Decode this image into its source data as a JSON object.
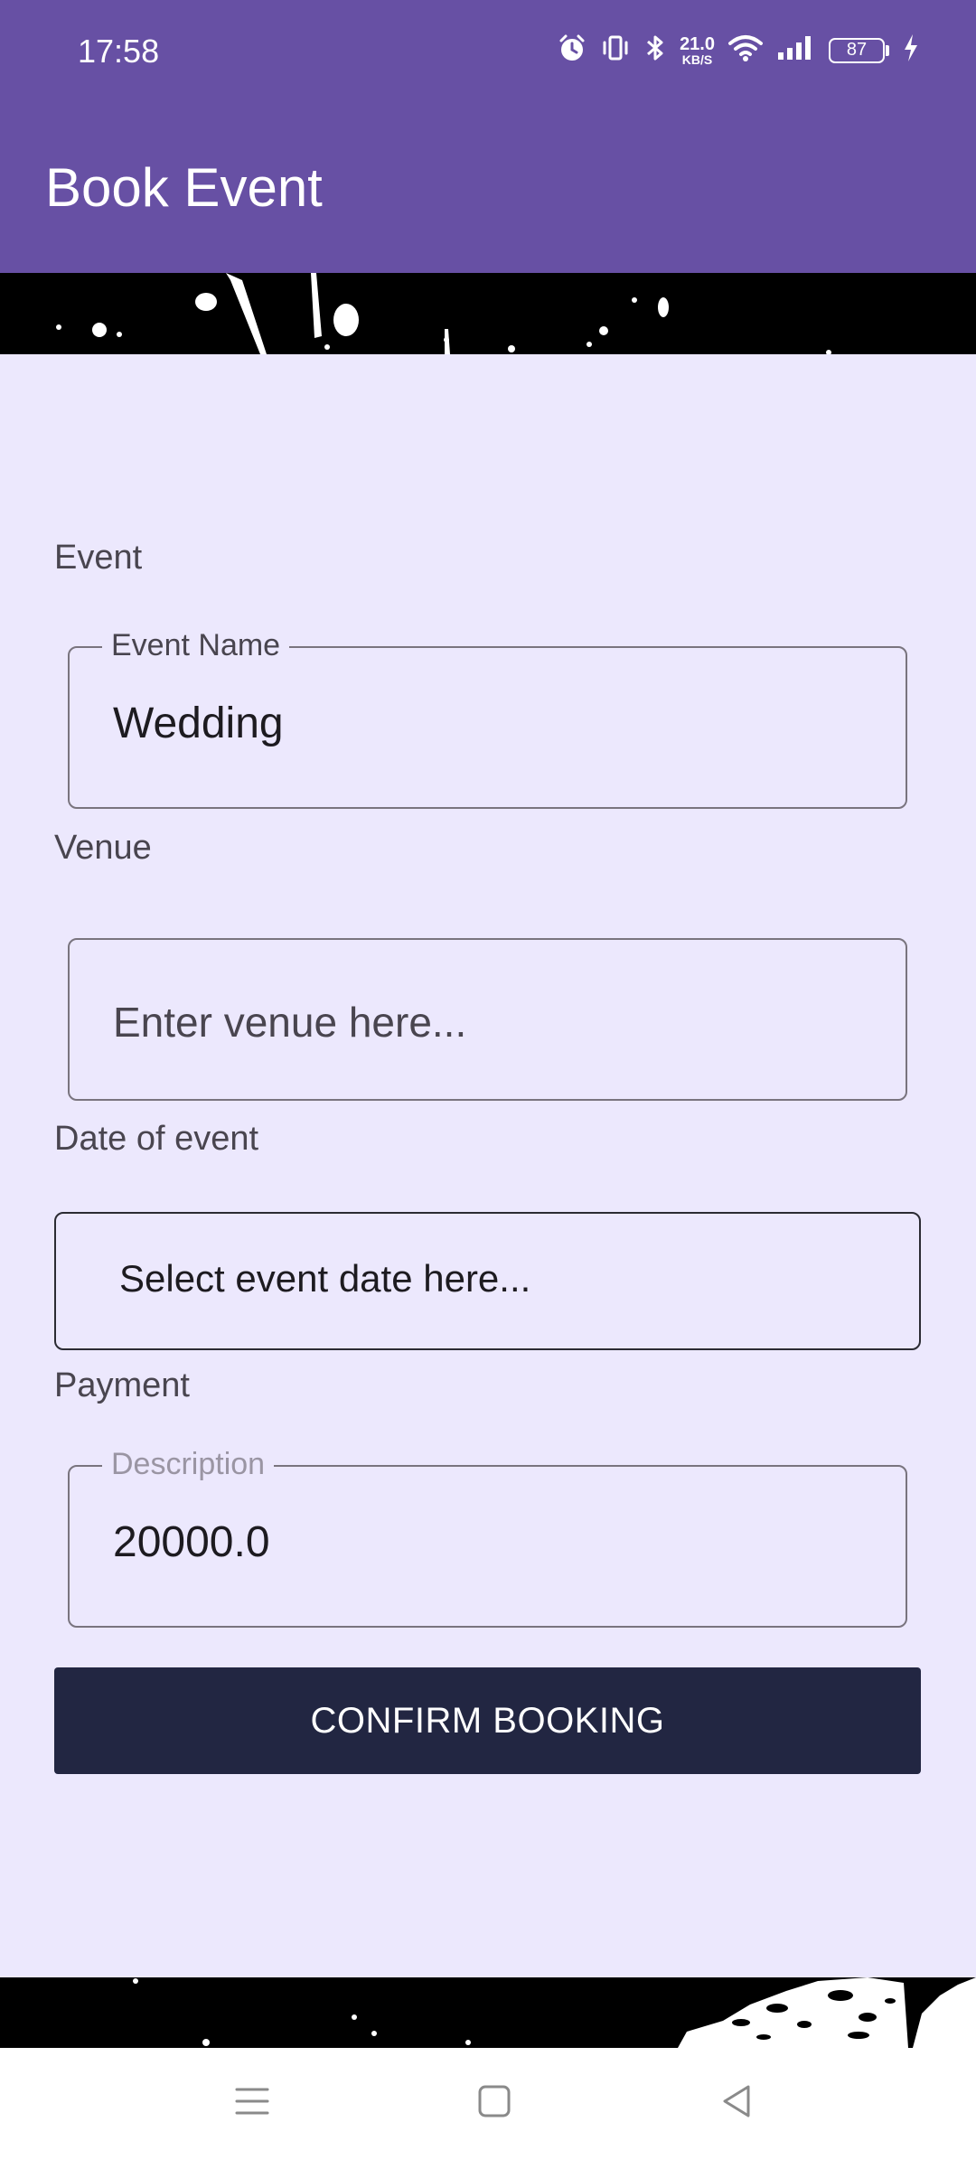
{
  "status_bar": {
    "time": "17:58",
    "net_speed_value": "21.0",
    "net_speed_unit": "KB/S",
    "battery": "87",
    "icons": [
      "alarm-icon",
      "vibrate-icon",
      "bluetooth-icon",
      "wifi-icon",
      "signal-icon",
      "battery-icon",
      "charging-icon"
    ]
  },
  "app_bar": {
    "title": "Book Event"
  },
  "form": {
    "event_section": "Event",
    "event_name_label": "Event Name",
    "event_name_value": "Wedding",
    "venue_section": "Venue",
    "venue_placeholder": "Enter venue here...",
    "date_section": "Date of event",
    "date_placeholder": "Select event date here...",
    "payment_section": "Payment",
    "description_label": "Description",
    "payment_value": "20000.0",
    "confirm_label": "CONFIRM BOOKING"
  },
  "colors": {
    "app_bar": "#6750a4",
    "form_background": "#ece8fd",
    "button": "#222642"
  },
  "nav_bar": {
    "icons": [
      "menu-icon",
      "home-icon",
      "back-icon"
    ]
  }
}
